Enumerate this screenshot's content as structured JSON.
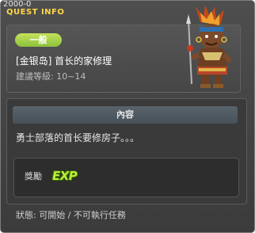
{
  "window": {
    "id": "2000-0",
    "title": "QUEST INFO"
  },
  "quest": {
    "category": "一般",
    "name": "[金银岛] 首长的家修理",
    "level": "建議等級: 10~14",
    "npc_icon": "tribal-chief-npc-icon"
  },
  "content": {
    "section_title": "內容",
    "description": "勇士部落的首长要修房子。。。"
  },
  "reward": {
    "label": "獎勵",
    "exp": "EXP"
  },
  "status": "狀態: 可開始 / 不可執行任務",
  "colors": {
    "title": "#ffd64a",
    "badge": "#9ccd46",
    "exp": "#b9f03a",
    "background": "#444444"
  }
}
